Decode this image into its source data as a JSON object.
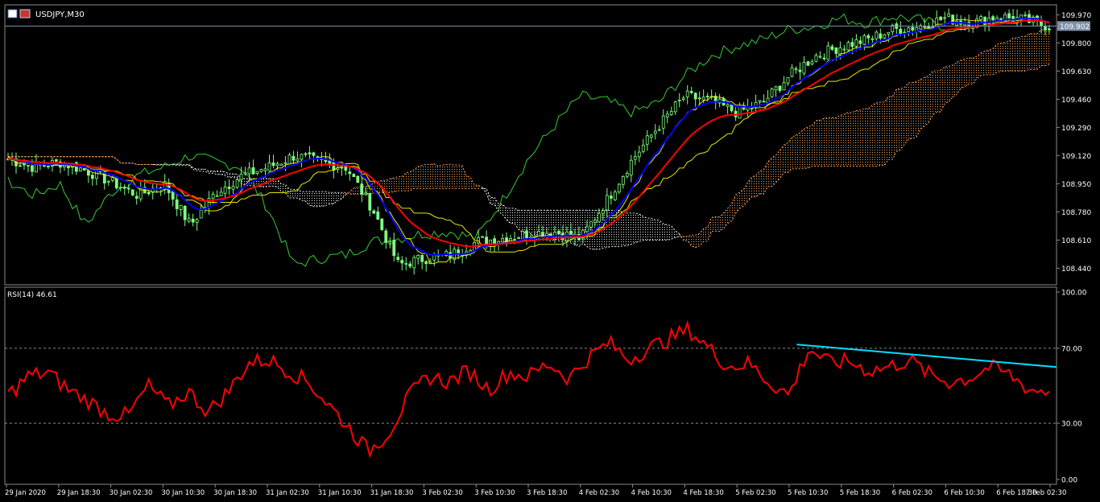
{
  "window": {
    "symbol_title": "USDJPY,M30"
  },
  "chart_data": [
    {
      "type": "candlestick",
      "symbol": "USDJPY",
      "timeframe": "M30",
      "title": "USDJPY,M30",
      "ylim": [
        108.34,
        110.03
      ],
      "y_ticks": [
        "109.970",
        "109.800",
        "109.630",
        "109.460",
        "109.290",
        "109.120",
        "108.950",
        "108.780",
        "108.610",
        "108.440"
      ],
      "current_price": "109.902",
      "x_ticks": [
        "29 Jan 2020",
        "29 Jan 18:30",
        "30 Jan 02:30",
        "30 Jan 10:30",
        "30 Jan 18:30",
        "31 Jan 02:30",
        "31 Jan 10:30",
        "31 Jan 18:30",
        "3 Feb 02:30",
        "3 Feb 10:30",
        "3 Feb 18:30",
        "4 Feb 02:30",
        "4 Feb 10:30",
        "4 Feb 18:30",
        "5 Feb 02:30",
        "5 Feb 10:30",
        "5 Feb 18:30",
        "6 Feb 02:30",
        "6 Feb 10:30",
        "6 Feb 18:30",
        "7 Feb 02:30"
      ],
      "close_anchors": [
        109.1,
        109.05,
        109.08,
        109.03,
        108.96,
        108.88,
        108.95,
        108.7,
        108.9,
        109.0,
        109.05,
        109.12,
        109.08,
        109.05,
        108.8,
        108.46,
        108.5,
        108.52,
        108.6,
        108.62,
        108.65,
        108.66,
        108.62,
        108.85,
        109.1,
        109.3,
        109.48,
        109.45,
        109.38,
        109.44,
        109.6,
        109.72,
        109.78,
        109.82,
        109.88,
        109.9,
        109.95,
        109.92,
        109.96,
        109.94,
        109.9
      ],
      "colors": {
        "candles": "#7fff7f",
        "ma_blue": "#0000ff",
        "ma_red": "#ff0000",
        "tenkan": "#e6e600",
        "chikou": "#33cc33",
        "cloud_bull": "#e8e8e8",
        "cloud_bear": "#f4a460",
        "price_line": "#7f8fa8"
      }
    },
    {
      "type": "line",
      "title": "RSI(14) 46.61",
      "indicator": "RSI",
      "period": 14,
      "last_value": 46.61,
      "ylim": [
        0,
        100
      ],
      "y_ticks": [
        "100.00",
        "70.00",
        "30.00",
        "0.00"
      ],
      "levels": [
        70,
        30
      ],
      "anchors": [
        45,
        55,
        57,
        48,
        42,
        35,
        34,
        50,
        39,
        47,
        36,
        47,
        62,
        64,
        58,
        52,
        40,
        28,
        15,
        25,
        44,
        55,
        52,
        58,
        48,
        57,
        55,
        62,
        54,
        65,
        73,
        64,
        70,
        75,
        80,
        70,
        60,
        62,
        52,
        45,
        70,
        62,
        63,
        58,
        60,
        64,
        56,
        52,
        54,
        60,
        56,
        48,
        47
      ],
      "trendline": {
        "from": [
          0.753,
          72
        ],
        "to": [
          1.0,
          60
        ]
      },
      "colors": {
        "line": "#ff0000",
        "trendline": "#00e0ff"
      }
    }
  ]
}
